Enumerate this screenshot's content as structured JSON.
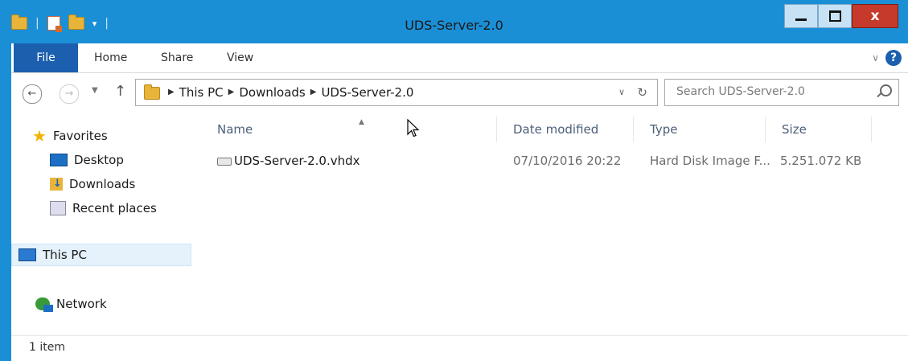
{
  "window": {
    "title": "UDS-Server-2.0",
    "close_label": "x"
  },
  "ribbon": {
    "tabs": [
      "File",
      "Home",
      "Share",
      "View"
    ]
  },
  "address": {
    "crumbs": [
      "This PC",
      "Downloads",
      "UDS-Server-2.0"
    ]
  },
  "search": {
    "placeholder": "Search UDS-Server-2.0"
  },
  "sidebar": {
    "favorites_label": "Favorites",
    "items": [
      "Desktop",
      "Downloads",
      "Recent places"
    ],
    "this_pc_label": "This PC",
    "network_label": "Network"
  },
  "columns": {
    "name": "Name",
    "date": "Date modified",
    "type": "Type",
    "size": "Size"
  },
  "files": [
    {
      "name": "UDS-Server-2.0.vhdx",
      "date": "07/10/2016 20:22",
      "type": "Hard Disk Image F...",
      "size": "5.251.072 KB"
    }
  ],
  "status": {
    "text": "1 item"
  },
  "colors": {
    "accent": "#1b8fd6",
    "file_tab": "#1b5fae",
    "close_button": "#c63a2c",
    "selected_nav": "#e5f1fb"
  }
}
